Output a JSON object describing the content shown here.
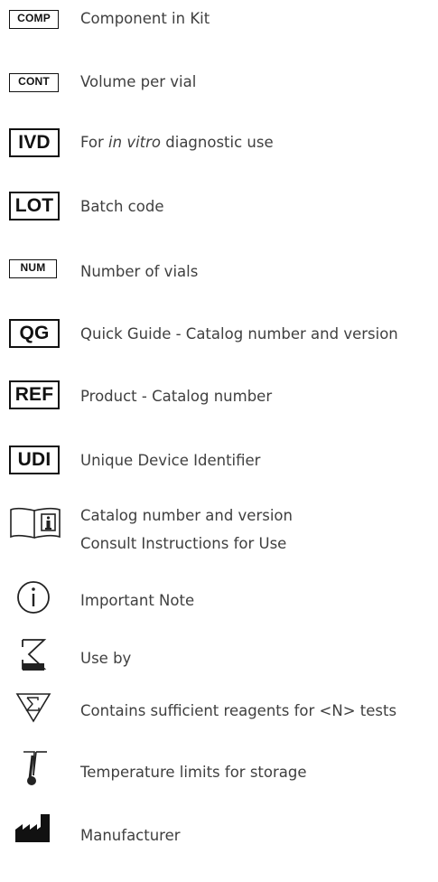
{
  "legend": [
    {
      "symbol": "COMP",
      "text": "Component in Kit"
    },
    {
      "symbol": "CONT",
      "text": "Volume per vial"
    },
    {
      "symbol": "IVD",
      "text_before": "For ",
      "text_italic": "in vitro",
      "text_after": " diagnostic use"
    },
    {
      "symbol": "LOT",
      "text": "Batch code"
    },
    {
      "symbol": "NUM",
      "text": "Number of vials"
    },
    {
      "symbol": "QG",
      "text": "Quick Guide - Catalog number and version"
    },
    {
      "symbol": "REF",
      "text": "Product - Catalog number"
    },
    {
      "symbol": "UDI",
      "text": "Unique Device Identifier"
    },
    {
      "symbol": "consult-instructions-icon",
      "text": "Catalog number and version",
      "text2": "Consult Instructions for Use"
    },
    {
      "symbol": "important-note-icon",
      "text": "Important Note"
    },
    {
      "symbol": "hourglass-icon",
      "text": "Use by"
    },
    {
      "symbol": "sigma-triangle-icon",
      "text": "Contains sufficient reagents for <N> tests"
    },
    {
      "symbol": "thermometer-icon",
      "text": "Temperature limits for storage"
    },
    {
      "symbol": "factory-icon",
      "text": "Manufacturer"
    }
  ]
}
